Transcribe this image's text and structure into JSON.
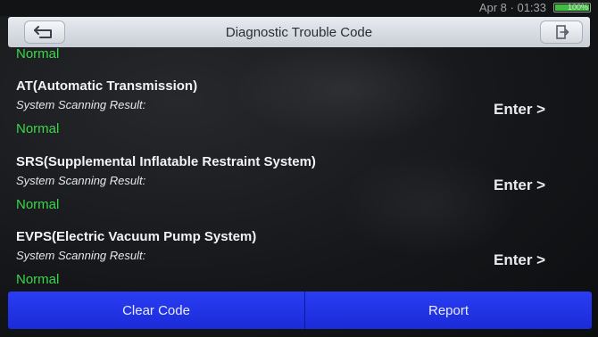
{
  "status_bar": {
    "time": "Apr 8 · 01:33",
    "battery": "100%",
    "battery_level": 1.0
  },
  "header": {
    "title": "Diagnostic Trouble Code"
  },
  "list": {
    "partial_status": "Normal",
    "modules": [
      {
        "name": "AT(Automatic Transmission)",
        "result_label": "System Scanning Result:",
        "status": "Normal",
        "enter_label": "Enter >"
      },
      {
        "name": "SRS(Supplemental Inflatable Restraint System)",
        "result_label": "System Scanning Result:",
        "status": "Normal",
        "enter_label": "Enter >"
      },
      {
        "name": "EVPS(Electric Vacuum Pump System)",
        "result_label": "System Scanning Result:",
        "status": "Normal",
        "enter_label": "Enter >"
      }
    ]
  },
  "bottom_bar": {
    "clear_code_label": "Clear Code",
    "report_label": "Report"
  },
  "colors": {
    "status_normal": "#3bd64a",
    "bottom_bar": "#2235e8",
    "header_bg": "#d9dde3"
  }
}
